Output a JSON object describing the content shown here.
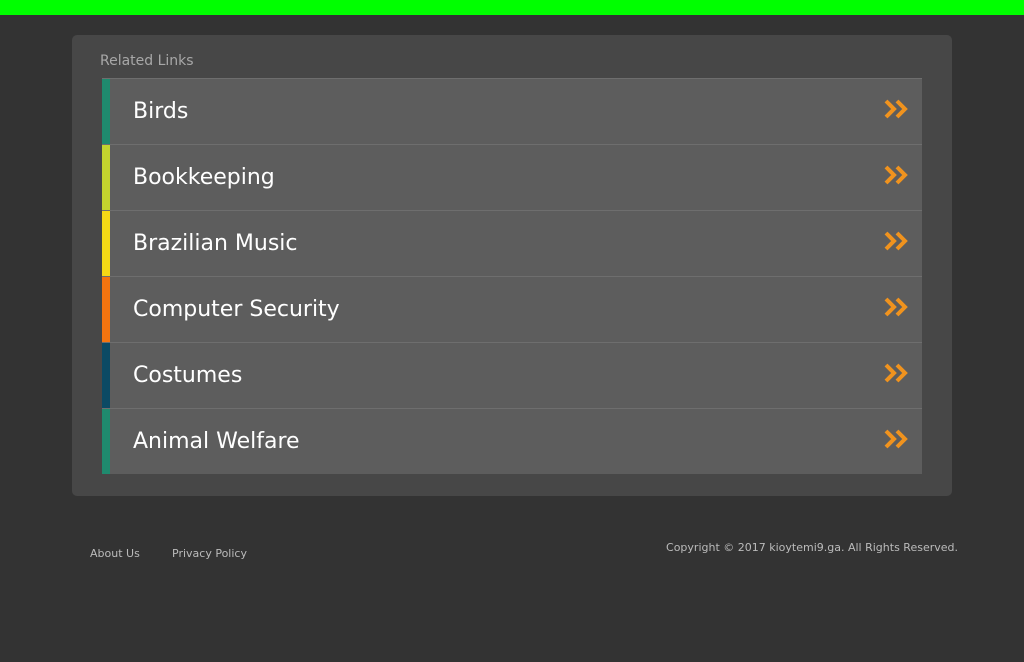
{
  "colors": {
    "accent_bar": "#00ff00",
    "chevron": "#f0931e"
  },
  "related": {
    "title": "Related Links",
    "items": [
      {
        "label": "Birds",
        "color": "#1f8a6e"
      },
      {
        "label": "Bookkeeping",
        "color": "#c3d42e"
      },
      {
        "label": "Brazilian Music",
        "color": "#f5d916"
      },
      {
        "label": "Computer Security",
        "color": "#f5740f"
      },
      {
        "label": "Costumes",
        "color": "#0b4a64"
      },
      {
        "label": "Animal Welfare",
        "color": "#1f8a6e"
      }
    ]
  },
  "footer": {
    "about": "About Us",
    "privacy": "Privacy Policy",
    "copyright": "Copyright © 2017 kioytemi9.ga. All Rights Reserved."
  }
}
